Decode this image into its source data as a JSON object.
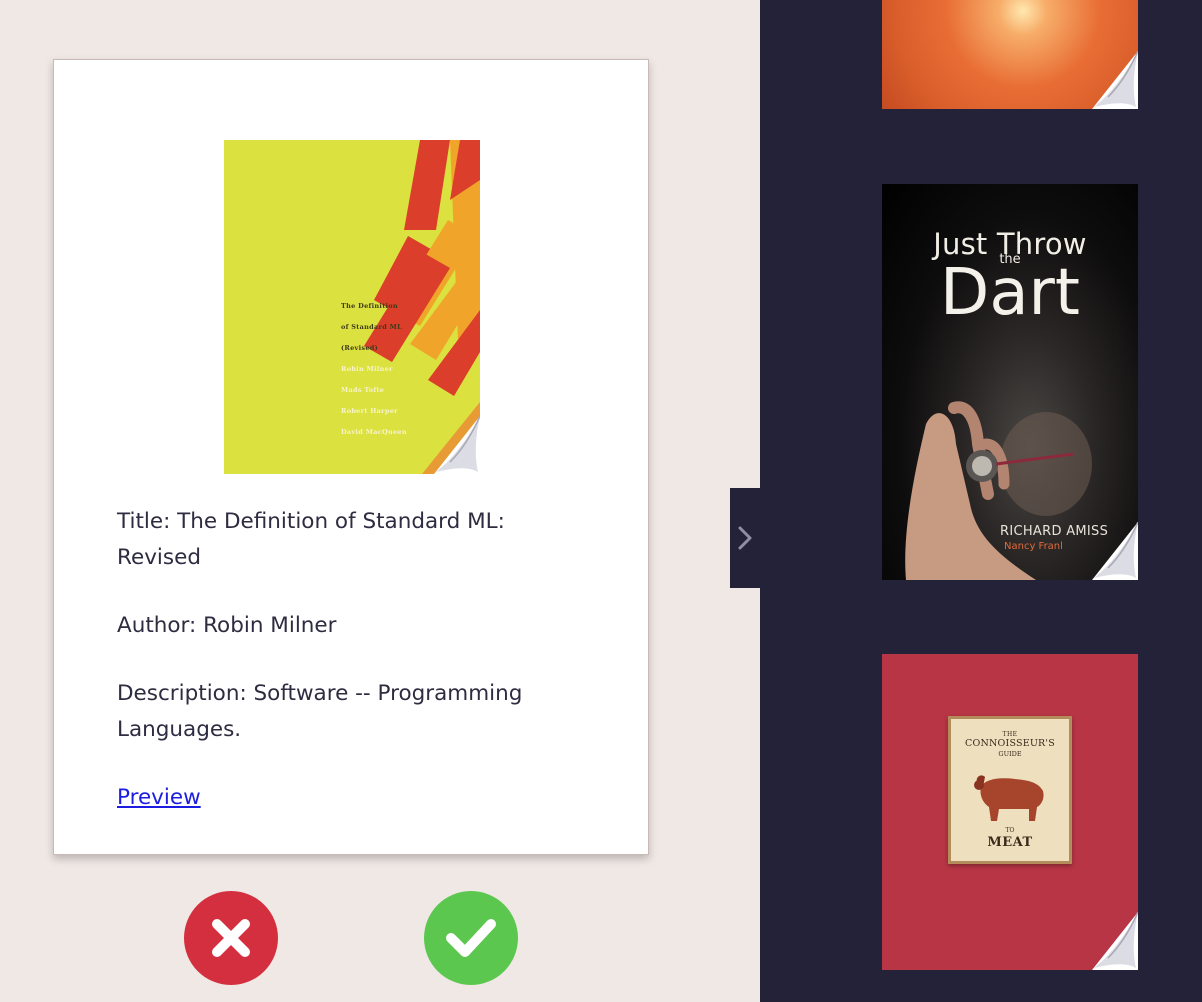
{
  "book": {
    "cover_lines": [
      "The Definition",
      "of Standard ML",
      "(Revised)",
      "Robin Milner",
      "Mads Tofte",
      "Robert Harper",
      "David MacQueen"
    ],
    "title_text": "Title: The Definition of Standard ML: Revised",
    "author_text": "Author: Robin Milner",
    "description_text": "Description: Software -- Programming Languages.",
    "preview_label": "Preview"
  },
  "actions": {
    "reject_icon": "close-icon",
    "accept_icon": "check-icon"
  },
  "colors": {
    "background": "#f0e8e5",
    "sidebar": "#232239",
    "reject": "#d42f3e",
    "accept": "#5cc74e",
    "link": "#1b1ee0"
  },
  "sidebar": {
    "toggle_icon": "chevron-right-icon",
    "suggestions": [
      {
        "cover_kind": "sun-photo"
      },
      {
        "cover_title_line1": "Just Throw",
        "cover_title_line2": "the",
        "cover_title_line3": "Dart",
        "cover_author": "RICHARD AMISS",
        "cover_foreword": "Nancy Franl"
      },
      {
        "cover_the": "THE",
        "cover_line1": "CONNOISSEUR'S",
        "cover_line2": "GUIDE",
        "cover_to": "TO",
        "cover_meat": "MEAT"
      }
    ]
  }
}
